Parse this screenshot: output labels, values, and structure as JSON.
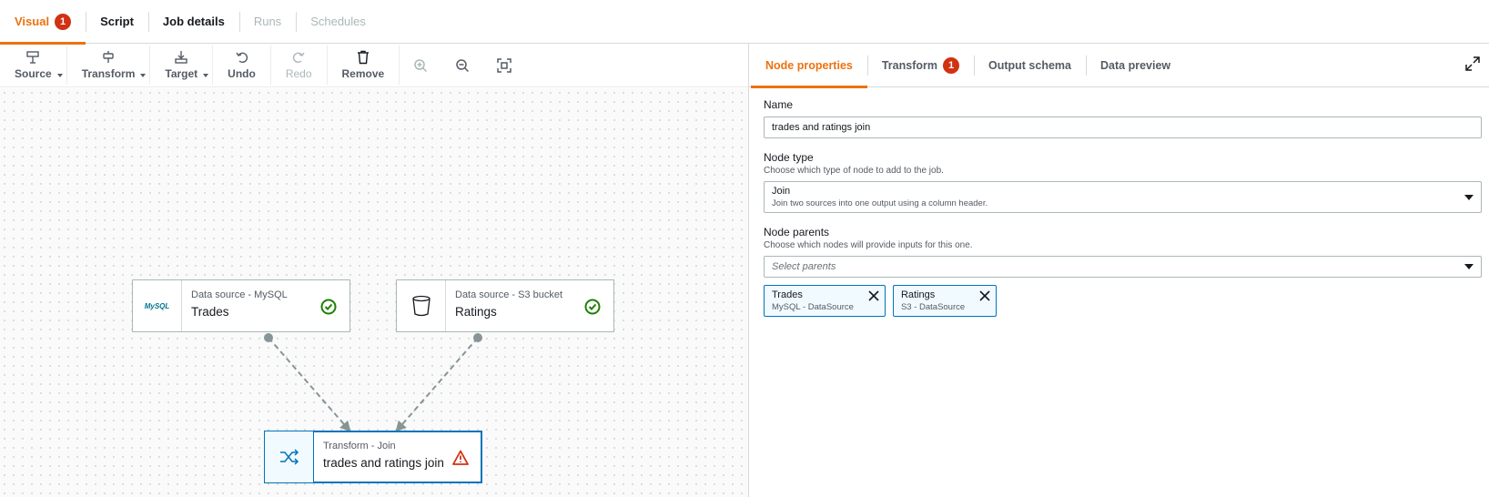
{
  "top_tabs": [
    {
      "label": "Visual",
      "badge": "1"
    },
    {
      "label": "Script"
    },
    {
      "label": "Job details"
    },
    {
      "label": "Runs"
    },
    {
      "label": "Schedules"
    }
  ],
  "toolbar": {
    "source": "Source",
    "transform": "Transform",
    "target": "Target",
    "undo": "Undo",
    "redo": "Redo",
    "remove": "Remove"
  },
  "nodes": {
    "trades": {
      "subtitle": "Data source - MySQL",
      "title": "Trades",
      "logo": "MySQL"
    },
    "ratings": {
      "subtitle": "Data source - S3 bucket",
      "title": "Ratings"
    },
    "join": {
      "subtitle": "Transform - Join",
      "title": "trades and ratings join"
    }
  },
  "panel": {
    "tabs": [
      {
        "label": "Node properties"
      },
      {
        "label": "Transform",
        "badge": "1"
      },
      {
        "label": "Output schema"
      },
      {
        "label": "Data preview"
      }
    ],
    "name_label": "Name",
    "name_value": "trades and ratings join",
    "node_type_label": "Node type",
    "node_type_desc": "Choose which type of node to add to the job.",
    "node_type_value": "Join",
    "node_type_value_desc": "Join two sources into one output using a column header.",
    "node_parents_label": "Node parents",
    "node_parents_desc": "Choose which nodes will provide inputs for this one.",
    "node_parents_placeholder": "Select parents",
    "parents": [
      {
        "name": "Trades",
        "type": "MySQL - DataSource"
      },
      {
        "name": "Ratings",
        "type": "S3 - DataSource"
      }
    ]
  },
  "colors": {
    "accent": "#ec7211",
    "badge": "#d13212",
    "selected": "#0073bb",
    "success": "#1d8102",
    "warning": "#d13212"
  }
}
